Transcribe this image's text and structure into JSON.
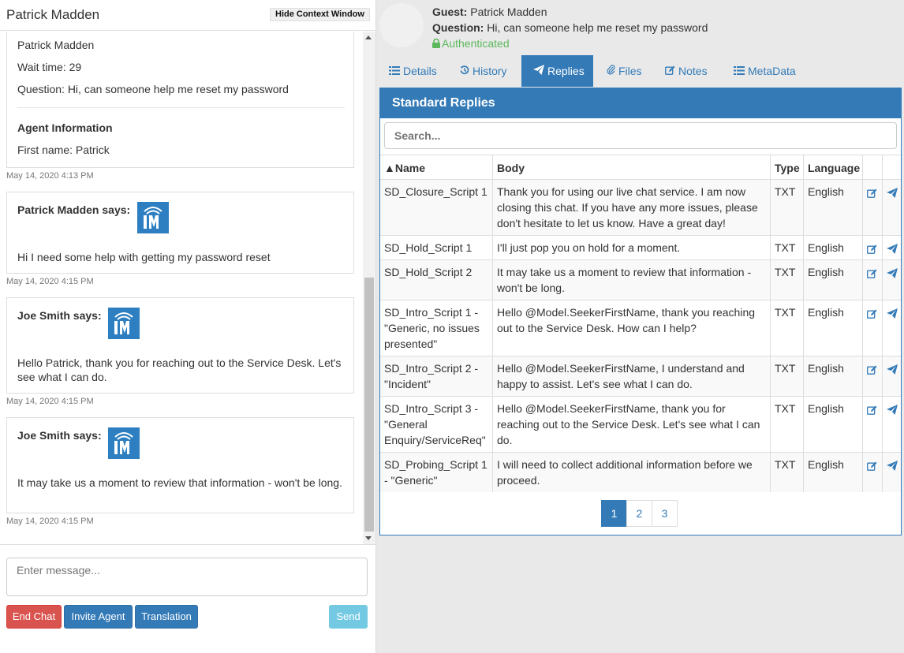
{
  "left_header": {
    "title": "Patrick Madden",
    "hide_button": "Hide Context Window"
  },
  "context_card": {
    "name": "Patrick Madden",
    "wait_time": "Wait time: 29",
    "question": "Question: Hi, can someone help me reset my password",
    "agent_heading": "Agent Information",
    "first_name": "First name: Patrick"
  },
  "messages": [
    {
      "stamp": "May 14, 2020 4:13 PM"
    },
    {
      "sender": "Patrick Madden says:",
      "text": "Hi I need some help with getting my password reset",
      "stamp": "May 14, 2020 4:15 PM"
    },
    {
      "sender": "Joe Smith says:",
      "text": "Hello Patrick, thank you for reaching out to the Service Desk. Let's see what I can do.",
      "stamp": "May 14, 2020 4:15 PM"
    },
    {
      "sender": "Joe Smith says:",
      "text": "It may take us a moment to review that information - won't be long.",
      "stamp": "May 14, 2020 4:15 PM"
    }
  ],
  "composer": {
    "placeholder": "Enter message...",
    "end_chat": "End Chat",
    "invite_agent": "Invite Agent",
    "translation": "Translation",
    "send": "Send"
  },
  "guest": {
    "guest_label": "Guest:",
    "guest_name": "Patrick Madden",
    "question_label": "Question:",
    "question_text": "Hi, can someone help me reset my password",
    "status": "Authenticated"
  },
  "tabs": [
    {
      "label": "Details",
      "icon": "list-icon"
    },
    {
      "label": "History",
      "icon": "history-icon"
    },
    {
      "label": "Replies",
      "icon": "send-icon"
    },
    {
      "label": "Files",
      "icon": "paperclip-icon"
    },
    {
      "label": "Notes",
      "icon": "edit-icon"
    },
    {
      "label": "MetaData",
      "icon": "list-icon"
    }
  ],
  "replies": {
    "title": "Standard Replies",
    "search_placeholder": "Search...",
    "columns": {
      "name": "▲Name",
      "body": "Body",
      "type": "Type",
      "language": "Language"
    },
    "rows": [
      {
        "name": "SD_Closure_Script 1",
        "body": "Thank you for using our live chat service. I am now closing this chat. If you have any more issues, please don't hesitate to let us know. Have a great day!",
        "type": "TXT",
        "language": "English"
      },
      {
        "name": "SD_Hold_Script 1",
        "body": "I'll just pop you on hold for a moment.",
        "type": "TXT",
        "language": "English"
      },
      {
        "name": "SD_Hold_Script 2",
        "body": "It may take us a moment to review that information - won't be long.",
        "type": "TXT",
        "language": "English"
      },
      {
        "name": "SD_Intro_Script 1 - \"Generic, no issues presented\"",
        "body": "Hello @Model.SeekerFirstName, thank you reaching out to the Service Desk. How can I help?",
        "type": "TXT",
        "language": "English"
      },
      {
        "name": "SD_Intro_Script 2 - \"Incident\"",
        "body": "Hello @Model.SeekerFirstName, I understand and happy to assist. Let's see what I can do.",
        "type": "TXT",
        "language": "English"
      },
      {
        "name": "SD_Intro_Script 3 - \"General Enquiry/ServiceReq\"",
        "body": "Hello @Model.SeekerFirstName, thank you for reaching out to the Service Desk. Let's see what I can do.",
        "type": "TXT",
        "language": "English"
      },
      {
        "name": "SD_Probing_Script 1 - \"Generic\"",
        "body": "I will need to collect additional information before we proceed.",
        "type": "TXT",
        "language": "English"
      }
    ],
    "pages": [
      "1",
      "2",
      "3"
    ]
  },
  "colors": {
    "primary": "#337ab7",
    "danger": "#d9534f",
    "info": "#5bc0de",
    "success": "#5cb85c"
  }
}
